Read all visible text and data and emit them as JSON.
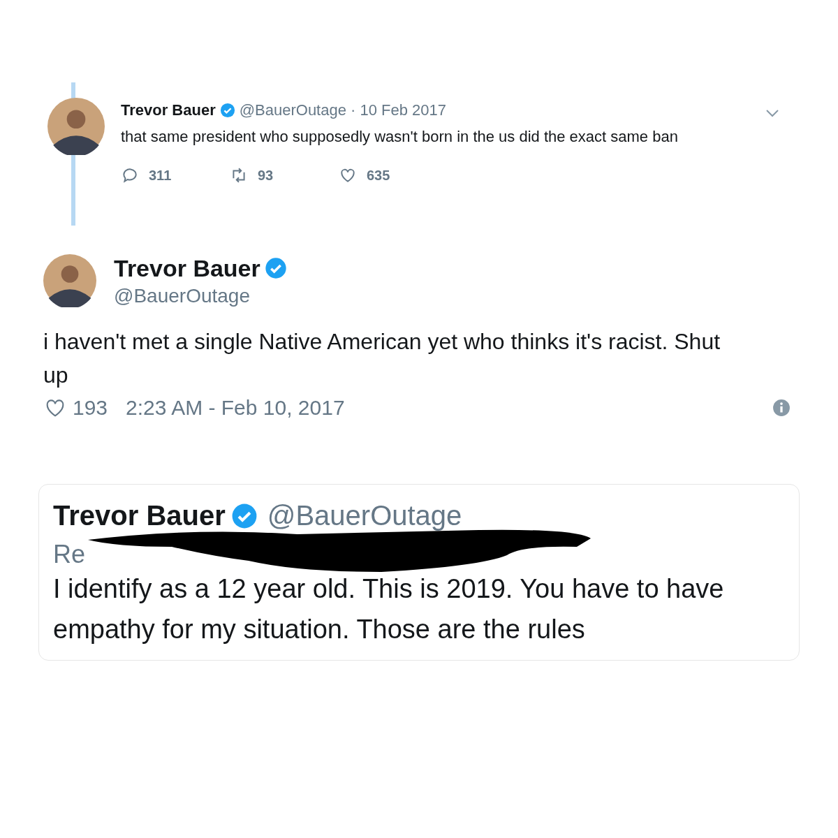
{
  "thread_tweet": {
    "name": "Trevor Bauer",
    "verified": true,
    "handle": "@BauerOutage",
    "date": "· 10 Feb 2017",
    "text": "that same president who supposedly wasn't born in the us did the exact same ban",
    "actions": [
      {
        "kind": "reply",
        "count": "311"
      },
      {
        "kind": "retweet",
        "count": "93"
      },
      {
        "kind": "like",
        "count": "635"
      }
    ]
  },
  "tweet": {
    "name": "Trevor Bauer",
    "verified": true,
    "handle": "@BauerOutage",
    "text": "i haven't met a single Native American yet who thinks it's racist. Shut up",
    "likes": "193",
    "timestamp": "2:23 AM - Feb 10, 2017"
  },
  "reply_tweet": {
    "name": "Trevor Bauer",
    "verified": true,
    "handle": "@BauerOutage",
    "replying_to": "Re",
    "redacted": true,
    "text": "I identify as a 12 year old. This is 2019. You have to have empathy for my situation. Those are the rules"
  }
}
